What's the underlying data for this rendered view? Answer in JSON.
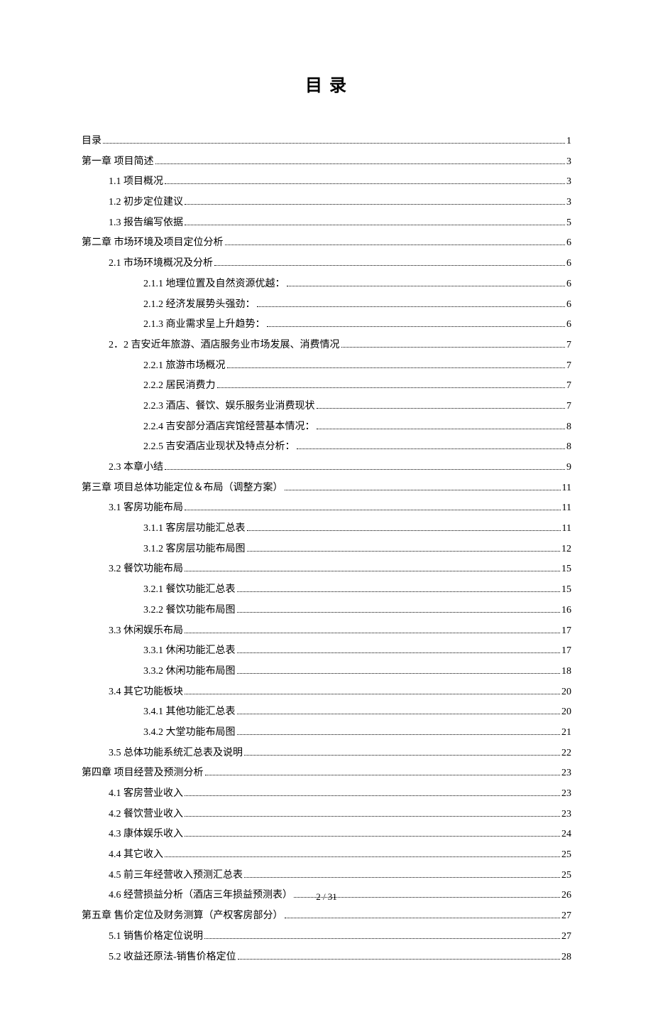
{
  "title": "目 录",
  "footer": "2 / 31",
  "entries": [
    {
      "level": 0,
      "label": "目录",
      "page": "1"
    },
    {
      "level": 0,
      "label": "第一章  项目简述",
      "page": "3"
    },
    {
      "level": 1,
      "label": "1.1 项目概况",
      "page": "3"
    },
    {
      "level": 1,
      "label": "1.2 初步定位建议",
      "page": "3"
    },
    {
      "level": 1,
      "label": "1.3 报告编写依据",
      "page": "5"
    },
    {
      "level": 0,
      "label": "第二章  市场环境及项目定位分析",
      "page": "6"
    },
    {
      "level": 1,
      "label": "2.1 市场环境概况及分析",
      "page": "6"
    },
    {
      "level": 2,
      "label": "2.1.1 地理位置及自然资源优越：",
      "page": "6"
    },
    {
      "level": 2,
      "label": "2.1.2 经济发展势头强劲：",
      "page": "6"
    },
    {
      "level": 2,
      "label": "2.1.3 商业需求呈上升趋势：",
      "page": "6"
    },
    {
      "level": 1,
      "label": "2．2 吉安近年旅游、酒店服务业市场发展、消费情况",
      "page": "7"
    },
    {
      "level": 2,
      "label": "2.2.1 旅游市场概况",
      "page": "7"
    },
    {
      "level": 2,
      "label": "2.2.2 居民消费力",
      "page": "7"
    },
    {
      "level": 2,
      "label": "2.2.3 酒店、餐饮、娱乐服务业消费现状",
      "page": "7"
    },
    {
      "level": 2,
      "label": "2.2.4 吉安部分酒店宾馆经营基本情况：",
      "page": "8"
    },
    {
      "level": 2,
      "label": "2.2.5 吉安酒店业现状及特点分析：",
      "page": "8"
    },
    {
      "level": 1,
      "label": "2.3 本章小结",
      "page": "9"
    },
    {
      "level": 0,
      "label": "第三章  项目总体功能定位＆布局（调整方案）",
      "page": "11"
    },
    {
      "level": 1,
      "label": "3.1 客房功能布局",
      "page": "11"
    },
    {
      "level": 2,
      "label": "3.1.1  客房层功能汇总表",
      "page": "11"
    },
    {
      "level": 2,
      "label": "3.1.2 客房层功能布局图",
      "page": "12"
    },
    {
      "level": 1,
      "label": "3.2 餐饮功能布局",
      "page": "15"
    },
    {
      "level": 2,
      "label": "3.2.1 餐饮功能汇总表",
      "page": "15"
    },
    {
      "level": 2,
      "label": "3.2.2 餐饮功能布局图",
      "page": "16"
    },
    {
      "level": 1,
      "label": "3.3 休闲娱乐布局",
      "page": "17"
    },
    {
      "level": 2,
      "label": "3.3.1  休闲功能汇总表",
      "page": "17"
    },
    {
      "level": 2,
      "label": "3.3.2  休闲功能布局图",
      "page": "18"
    },
    {
      "level": 1,
      "label": "3.4 其它功能板块",
      "page": "20"
    },
    {
      "level": 2,
      "label": "3.4.1  其他功能汇总表",
      "page": "20"
    },
    {
      "level": 2,
      "label": "3.4.2  大堂功能布局图",
      "page": "21"
    },
    {
      "level": 1,
      "label": "3.5 总体功能系统汇总表及说明",
      "page": "22"
    },
    {
      "level": 0,
      "label": "第四章  项目经营及预测分析",
      "page": "23"
    },
    {
      "level": 1,
      "label": "4.1 客房营业收入",
      "page": "23"
    },
    {
      "level": 1,
      "label": "4.2 餐饮营业收入",
      "page": "23"
    },
    {
      "level": 1,
      "label": "4.3 康体娱乐收入",
      "page": "24"
    },
    {
      "level": 1,
      "label": "4.4 其它收入",
      "page": "25"
    },
    {
      "level": 1,
      "label": "4.5 前三年经营收入预测汇总表",
      "page": "25"
    },
    {
      "level": 1,
      "label": "4.6 经营损益分析（酒店三年损益预测表）",
      "page": "26"
    },
    {
      "level": 0,
      "label": "第五章  售价定位及财务测算（产权客房部分）",
      "page": "27"
    },
    {
      "level": 1,
      "label": "5.1 销售价格定位说明",
      "page": "27"
    },
    {
      "level": 1,
      "label": "5.2 收益还原法-销售价格定位",
      "page": "28"
    }
  ]
}
